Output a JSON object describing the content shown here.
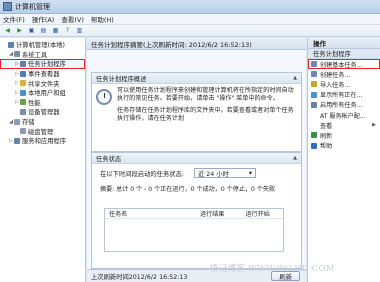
{
  "window": {
    "title": "计算机管理"
  },
  "menu": [
    "文件(F)",
    "操作(A)",
    "查看(V)",
    "帮助(H)"
  ],
  "tree": [
    {
      "label": "计算机管理(本地)",
      "level": 0,
      "exp": "",
      "color": "#5a7fb0"
    },
    {
      "label": "系统工具",
      "level": 1,
      "exp": "◢",
      "color": "#7d8fa8"
    },
    {
      "label": "任务计划程序",
      "level": 2,
      "exp": "▷",
      "color": "#6a7f99",
      "selected": true
    },
    {
      "label": "事件查看器",
      "level": 2,
      "exp": "▷",
      "color": "#4d7bc0"
    },
    {
      "label": "共享文件夹",
      "level": 2,
      "exp": "▷",
      "color": "#d9b23e"
    },
    {
      "label": "本地用户和组",
      "level": 2,
      "exp": "▷",
      "color": "#4f8fd0"
    },
    {
      "label": "性能",
      "level": 2,
      "exp": "▷",
      "color": "#6aa048"
    },
    {
      "label": "设备管理器",
      "level": 2,
      "exp": "",
      "color": "#7a8ea8"
    },
    {
      "label": "存储",
      "level": 1,
      "exp": "◢",
      "color": "#8a9bb3"
    },
    {
      "label": "磁盘管理",
      "level": 2,
      "exp": "",
      "color": "#8a9bb3"
    },
    {
      "label": "服务和应用程序",
      "level": 1,
      "exp": "▷",
      "color": "#6b84a6"
    }
  ],
  "center": {
    "header": "任务计划程序摘要(上次刷新时间: 2012/6/2 16:52:13)",
    "overview": {
      "title": "任务计划程序概述",
      "para1": "可以使用任务计划程序来创建和管理计算机将在所指定的时间自动执行的常见任务。若要开始，请单击 \"操作\" 菜单中的命令。",
      "para2": "任务存储在任务计划程序库的文件夹中。若要查看或者对单个任务执行操作，请在任务计划"
    },
    "status": {
      "title": "任务状态",
      "label": "在以下时间段启动的任务状态:",
      "dropdown": "近 24 小时",
      "summary": "摘要: 总计 0 个 - 0 个正在运行，0 个成功，0 个停止，0 个失败"
    },
    "grid": {
      "col1": "任务名",
      "col2": "运行结果",
      "col3": "运行开始"
    },
    "footer": {
      "last_refresh": "上次刷新时间2012/6/2 16:52:13",
      "refresh_label": "刷新"
    }
  },
  "actions": {
    "title": "操作",
    "subheader": "任务计划程序",
    "items": [
      {
        "label": "创建基本任务...",
        "color": "#6d87b3",
        "highlight": true
      },
      {
        "label": "创建任务...",
        "color": "#6d87b3"
      },
      {
        "label": "导入任务...",
        "color": "#c9a23a"
      },
      {
        "label": "显示所有正在...",
        "color": "#4f8fd0"
      },
      {
        "label": "启用所有任务...",
        "color": "#6a7f99"
      },
      {
        "label": "AT 服务帐户配...",
        "color": "#ffffff"
      },
      {
        "label": "查看",
        "color": "#ffffff",
        "arrow": true
      },
      {
        "label": "刷新",
        "color": "#3c8d3c"
      },
      {
        "label": "帮助",
        "color": "#2f6fc0"
      }
    ]
  },
  "watermark": "悟记博客 WWW.90LHD.COM"
}
